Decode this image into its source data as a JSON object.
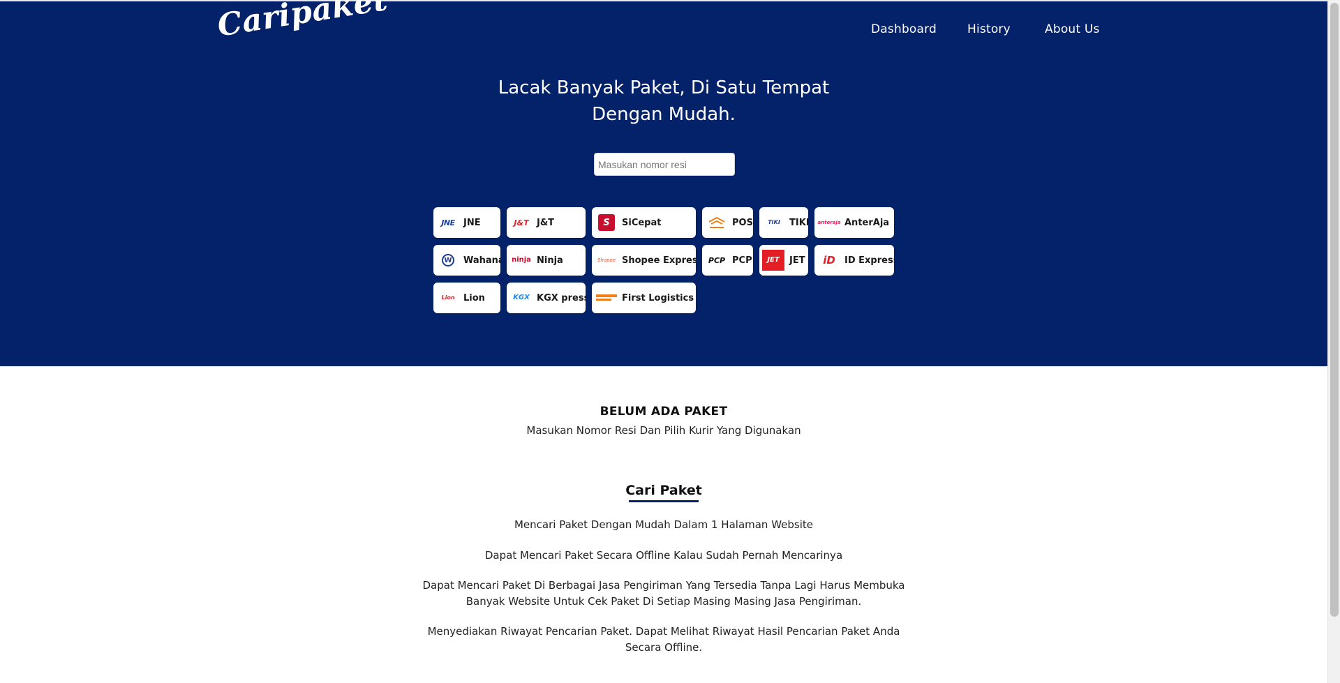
{
  "header": {
    "logo_text": "Caripaket",
    "nav": {
      "dashboard": "Dashboard",
      "history": "History",
      "about": "About Us"
    }
  },
  "hero": {
    "title_line1": "Lacak Banyak Paket, Di Satu Tempat",
    "title_line2": "Dengan Mudah.",
    "search_placeholder": "Masukan nomor resi",
    "search_value": ""
  },
  "couriers": [
    {
      "label": "JNE",
      "logo": "JNE",
      "logo_color": "#1a3fa0",
      "accent": "#e31e24",
      "icon": "jne-logo-icon"
    },
    {
      "label": "J&T",
      "logo": "J&T",
      "logo_color": "#e31e24",
      "accent": "#e31e24",
      "icon": "jnt-logo-icon"
    },
    {
      "label": "SiCepat",
      "logo": "S",
      "logo_color": "#ffffff",
      "accent": "#c8102e",
      "icon": "sicepat-logo-icon"
    },
    {
      "label": "POS",
      "logo": "POS",
      "logo_color": "#f07f1a",
      "accent": "#f07f1a",
      "icon": "pos-logo-icon"
    },
    {
      "label": "TIKI",
      "logo": "TIKI",
      "logo_color": "#1e3e9c",
      "accent": "#e31e24",
      "icon": "tiki-logo-icon"
    },
    {
      "label": "AnterAja",
      "logo": "anteraja",
      "logo_color": "#e91e63",
      "accent": "#f9a825",
      "icon": "anteraja-logo-icon"
    },
    {
      "label": "Wahana",
      "logo": "W",
      "logo_color": "#1e3e9c",
      "accent": "#1e3e9c",
      "icon": "wahana-logo-icon"
    },
    {
      "label": "Ninja",
      "logo": "ninja",
      "logo_color": "#c8102e",
      "accent": "#c8102e",
      "icon": "ninja-logo-icon"
    },
    {
      "label": "Shopee Express",
      "logo": "Shopee",
      "logo_color": "#ee4d2d",
      "accent": "#ee4d2d",
      "icon": "shopee-express-logo-icon"
    },
    {
      "label": "PCP",
      "logo": "PCP",
      "logo_color": "#111111",
      "accent": "#e31e24",
      "icon": "pcp-logo-icon"
    },
    {
      "label": "JET",
      "logo": "JET",
      "logo_color": "#ffffff",
      "accent": "#e31e24",
      "icon": "jet-logo-icon"
    },
    {
      "label": "ID Express",
      "logo": "iD",
      "logo_color": "#e31e24",
      "accent": "#e31e24",
      "icon": "id-express-logo-icon"
    },
    {
      "label": "Lion",
      "logo": "Lion",
      "logo_color": "#e31e24",
      "accent": "#e31e24",
      "icon": "lion-logo-icon"
    },
    {
      "label": "KGX press",
      "logo": "KGX",
      "logo_color": "#1e88e5",
      "accent": "#1e88e5",
      "icon": "kgx-logo-icon"
    },
    {
      "label": "First Logistics",
      "logo": "FL",
      "logo_color": "#f07f1a",
      "accent": "#f07f1a",
      "icon": "first-logistics-logo-icon"
    }
  ],
  "empty_state": {
    "title": "BELUM ADA PAKET",
    "subtitle": "Masukan Nomor Resi Dan Pilih Kurir Yang Digunakan"
  },
  "features": {
    "title": "Cari Paket",
    "items": [
      "Mencari Paket Dengan Mudah Dalam 1 Halaman Website",
      "Dapat Mencari Paket Secara Offline Kalau Sudah Pernah Mencarinya",
      "Dapat Mencari Paket Di Berbagai Jasa Pengiriman Yang Tersedia Tanpa Lagi Harus Membuka Banyak Website Untuk Cek Paket Di Setiap Masing Masing Jasa Pengiriman.",
      "Menyediakan Riwayat Pencarian Paket. Dapat Melihat Riwayat Hasil Pencarian Paket Anda Secara Offline."
    ]
  },
  "colors": {
    "hero_bg": "#04226a",
    "accent": "#04226a",
    "button_bg": "#ffffff"
  }
}
